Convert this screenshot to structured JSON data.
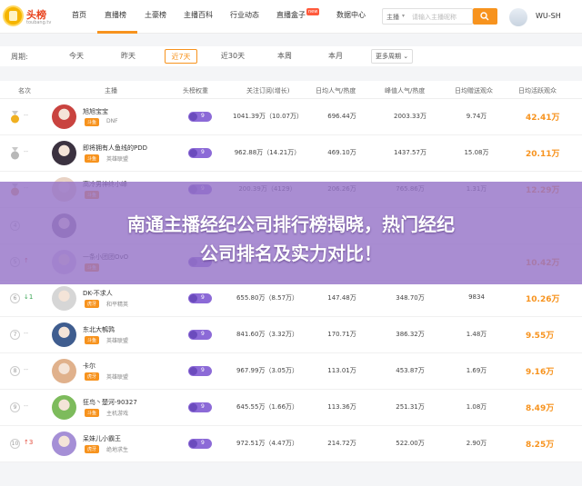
{
  "logo": {
    "text": "头榜",
    "sub": "toubang.tv"
  },
  "nav": {
    "items": [
      "首页",
      "直播榜",
      "土豪榜",
      "主播百科",
      "行业动态",
      "直播盒子",
      "数据中心"
    ],
    "active_index": 1,
    "new_badge": "new"
  },
  "search": {
    "scope": "主播",
    "placeholder": "请输入主播昵称",
    "icon": "search-icon"
  },
  "user": {
    "name": "WU-SH"
  },
  "colors": {
    "accent": "#f7931e",
    "weight_badge": "#8c6ad7",
    "banner": "#9674c8"
  },
  "period": {
    "label": "周期:",
    "options": [
      "今天",
      "昨天",
      "近7天",
      "近30天",
      "本周",
      "本月"
    ],
    "active_index": 2,
    "more": "更多周期"
  },
  "table": {
    "headers": [
      "名次",
      "主播",
      "头榜权重",
      "关注订阅(增长)",
      "日均人气/热度",
      "峰值人气/热度",
      "日均赠送观众",
      "日均活跃观众"
    ],
    "rows": [
      {
        "rank": "1",
        "rank_icon": "gold-medal-icon",
        "trend": "--",
        "name": "旭旭宝宝",
        "platform": "斗鱼",
        "game": "DNF",
        "weight": "9",
        "follow": "1041.39万（10.07万）",
        "avg_pop": "696.44万",
        "peak_pop": "2003.33万",
        "gift": "9.74万",
        "active": "42.41万"
      },
      {
        "rank": "2",
        "rank_icon": "silver-medal-icon",
        "trend": "--",
        "name": "即将拥有人鱼线的PDD",
        "platform": "斗鱼",
        "game": "英雄联盟",
        "weight": "9",
        "follow": "962.88万（14.21万）",
        "avg_pop": "469.10万",
        "peak_pop": "1437.57万",
        "gift": "15.08万",
        "active": "20.11万"
      },
      {
        "rank": "3",
        "rank_icon": "bronze-medal-icon",
        "trend": "--",
        "name": "高冷男神终小峰",
        "platform": "斗鱼",
        "game": "",
        "weight": "9",
        "follow": "200.39万（4129）",
        "avg_pop": "206.26万",
        "peak_pop": "765.86万",
        "gift": "1.31万",
        "active": "12.29万"
      },
      {
        "rank": "4",
        "rank_icon": "",
        "trend": "",
        "name": "",
        "platform": "",
        "game": "",
        "weight": "",
        "follow": "",
        "avg_pop": "",
        "peak_pop": "",
        "gift": "",
        "active": ""
      },
      {
        "rank": "5",
        "rank_icon": "",
        "trend": "↑",
        "name": "一条小团团OvO",
        "platform": "斗鱼",
        "game": "",
        "weight": "9",
        "follow": "",
        "avg_pop": "",
        "peak_pop": "",
        "gift": "",
        "active": "10.42万"
      },
      {
        "rank": "6",
        "rank_icon": "",
        "trend": "↓1",
        "name": "DK-不求人",
        "platform": "虎牙",
        "game": "和平精英",
        "weight": "9",
        "follow": "655.80万（8.57万）",
        "avg_pop": "147.48万",
        "peak_pop": "348.70万",
        "gift": "9834",
        "active": "10.26万"
      },
      {
        "rank": "7",
        "rank_icon": "",
        "trend": "--",
        "name": "东北大鹌鹑",
        "platform": "斗鱼",
        "game": "英雄联盟",
        "weight": "9",
        "follow": "841.60万（3.32万）",
        "avg_pop": "170.71万",
        "peak_pop": "386.32万",
        "gift": "1.48万",
        "active": "9.55万"
      },
      {
        "rank": "8",
        "rank_icon": "",
        "trend": "--",
        "name": "卡尔",
        "platform": "虎牙",
        "game": "英雄联盟",
        "weight": "9",
        "follow": "967.99万（3.05万）",
        "avg_pop": "113.01万",
        "peak_pop": "453.87万",
        "gift": "1.69万",
        "active": "9.16万"
      },
      {
        "rank": "9",
        "rank_icon": "",
        "trend": "--",
        "name": "狂鸟丶楚河-90327",
        "platform": "斗鱼",
        "game": "主机游戏",
        "weight": "9",
        "follow": "645.55万（1.66万）",
        "avg_pop": "113.36万",
        "peak_pop": "251.31万",
        "gift": "1.08万",
        "active": "8.49万"
      },
      {
        "rank": "10",
        "rank_icon": "",
        "trend": "↑3",
        "name": "呆妹儿小霸王",
        "platform": "虎牙",
        "game": "绝地求生",
        "weight": "9",
        "follow": "972.51万（4.47万）",
        "avg_pop": "214.72万",
        "peak_pop": "522.00万",
        "gift": "2.90万",
        "active": "8.25万"
      }
    ]
  },
  "banner": {
    "line1": "南通主播经纪公司排行榜揭晓，热门经纪",
    "line2": "公司排名及实力对比！"
  }
}
